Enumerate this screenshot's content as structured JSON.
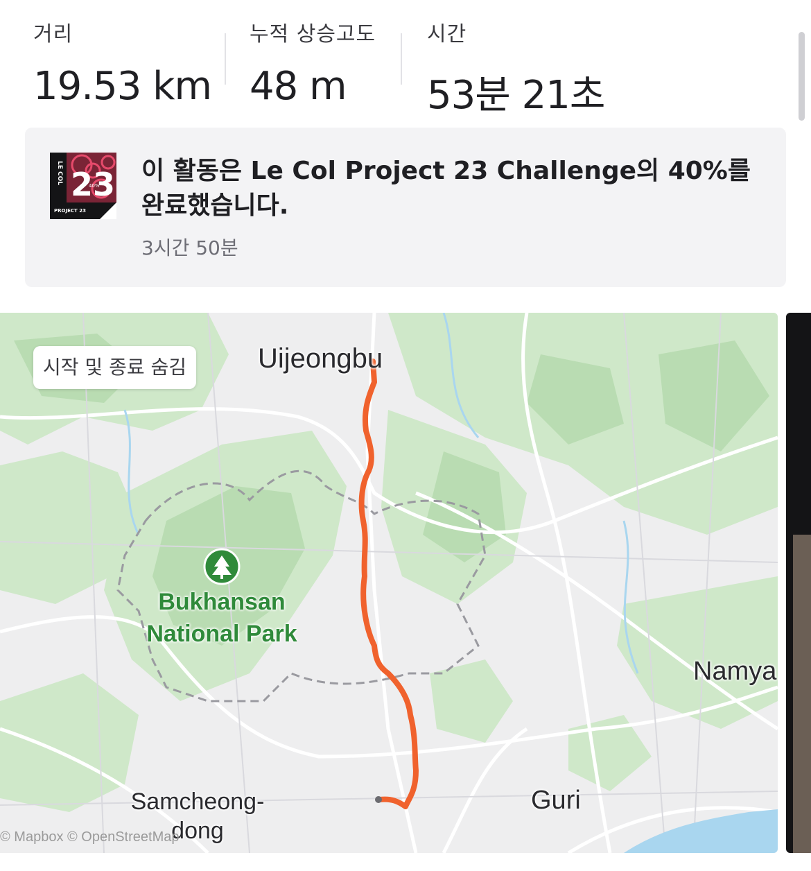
{
  "stats": [
    {
      "label": "거리",
      "value": "19.53 km"
    },
    {
      "label": "누적 상승고도",
      "value": "48 m"
    },
    {
      "label": "시간",
      "value": "53분 21초"
    }
  ],
  "challenge": {
    "badge_brand": "LE COL",
    "badge_number": "23",
    "badge_percent": "40%",
    "badge_caption": "PROJECT 23",
    "title": "이 활동은 Le Col Project 23 Challenge의 40%를 완료했습니다.",
    "time_ago": "3시간 50분",
    "progress": 0.4
  },
  "map": {
    "hide_button_label": "시작 및 종료 숨김",
    "labels": {
      "uijeongbu": "Uijeongbu",
      "park": "Bukhansan National Park",
      "namyang": "Namya",
      "samcheong": "Samcheong-dong",
      "guri": "Guri"
    },
    "attribution": "© Mapbox © OpenStreetMap",
    "route_color": "#f0622d",
    "park_color": "#2f8a3a"
  }
}
